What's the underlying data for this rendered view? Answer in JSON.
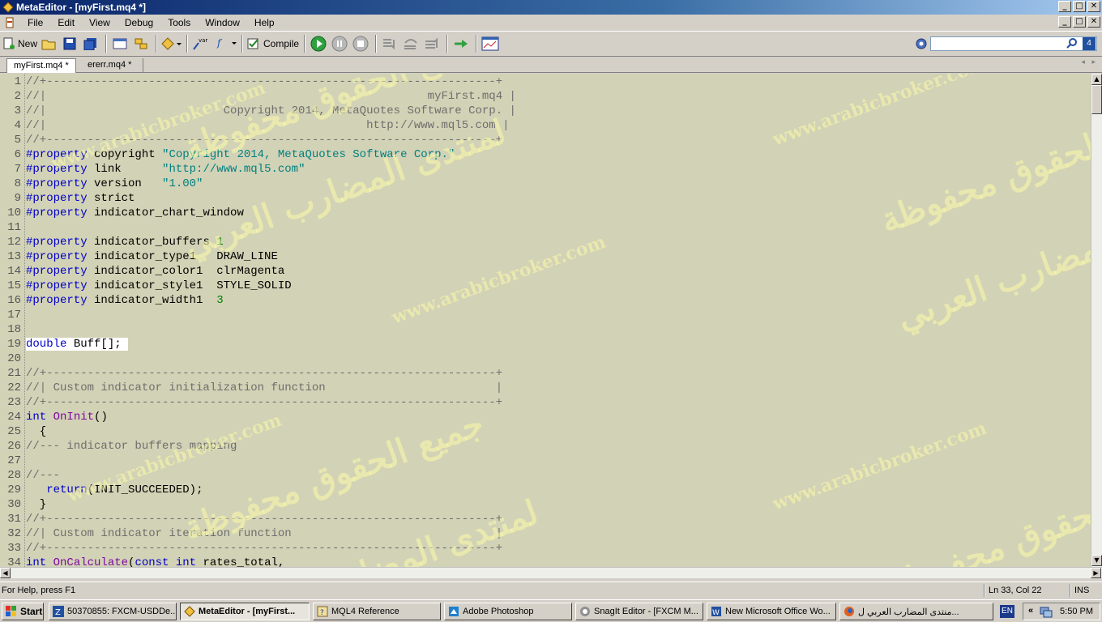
{
  "window": {
    "title": "MetaEditor - [myFirst.mq4 *]"
  },
  "menu": [
    "File",
    "Edit",
    "View",
    "Debug",
    "Tools",
    "Window",
    "Help"
  ],
  "toolbar": {
    "new_label": "New",
    "compile_label": "Compile"
  },
  "search": {
    "value": ""
  },
  "search_count": "4",
  "tabs": [
    {
      "label": "myFirst.mq4 *",
      "active": true
    },
    {
      "label": "ererr.mq4 *",
      "active": false
    }
  ],
  "code_lines": [
    [
      {
        "t": "//+------------------------------------------------------------------+",
        "c": "cmt"
      }
    ],
    [
      {
        "t": "//|                                                        myFirst.mq4 |",
        "c": "cmt"
      }
    ],
    [
      {
        "t": "//|                          Copyright 2014, MetaQuotes Software Corp. |",
        "c": "cmt"
      }
    ],
    [
      {
        "t": "//|                                               http://www.mql5.com |",
        "c": "cmt"
      }
    ],
    [
      {
        "t": "//+------------------------------------------------------------------+",
        "c": "cmt"
      }
    ],
    [
      {
        "t": "#property",
        "c": "kw"
      },
      {
        "t": " copyright ",
        "c": ""
      },
      {
        "t": "\"Copyright 2014, MetaQuotes Software Corp.\"",
        "c": "str"
      }
    ],
    [
      {
        "t": "#property",
        "c": "kw"
      },
      {
        "t": " link      ",
        "c": ""
      },
      {
        "t": "\"http://www.mql5.com\"",
        "c": "str"
      }
    ],
    [
      {
        "t": "#property",
        "c": "kw"
      },
      {
        "t": " version   ",
        "c": ""
      },
      {
        "t": "\"1.00\"",
        "c": "str"
      }
    ],
    [
      {
        "t": "#property",
        "c": "kw"
      },
      {
        "t": " strict",
        "c": ""
      }
    ],
    [
      {
        "t": "#property",
        "c": "kw"
      },
      {
        "t": " indicator_chart_window",
        "c": ""
      }
    ],
    [],
    [
      {
        "t": "#property",
        "c": "kw"
      },
      {
        "t": " indicator_buffers ",
        "c": ""
      },
      {
        "t": "1",
        "c": "num"
      }
    ],
    [
      {
        "t": "#property",
        "c": "kw"
      },
      {
        "t": " indicator_type1   DRAW_LINE",
        "c": ""
      }
    ],
    [
      {
        "t": "#property",
        "c": "kw"
      },
      {
        "t": " indicator_color1  clrMagenta",
        "c": ""
      }
    ],
    [
      {
        "t": "#property",
        "c": "kw"
      },
      {
        "t": " indicator_style1  STYLE_SOLID",
        "c": ""
      }
    ],
    [
      {
        "t": "#property",
        "c": "kw"
      },
      {
        "t": " indicator_width1  ",
        "c": ""
      },
      {
        "t": "3",
        "c": "num"
      }
    ],
    [],
    [],
    [
      {
        "t": "double",
        "c": "kw hl"
      },
      {
        "t": " Buff[]; ",
        "c": "hl"
      }
    ],
    [],
    [
      {
        "t": "//+------------------------------------------------------------------+",
        "c": "cmt"
      }
    ],
    [
      {
        "t": "//| Custom indicator initialization function                         |",
        "c": "cmt"
      }
    ],
    [
      {
        "t": "//+------------------------------------------------------------------+",
        "c": "cmt"
      }
    ],
    [
      {
        "t": "int",
        "c": "kw"
      },
      {
        "t": " ",
        "c": ""
      },
      {
        "t": "OnInit",
        "c": "fn"
      },
      {
        "t": "()",
        "c": ""
      }
    ],
    [
      {
        "t": "  {",
        "c": ""
      }
    ],
    [
      {
        "t": "//--- indicator buffers mapping",
        "c": "cmt"
      }
    ],
    [],
    [
      {
        "t": "//---",
        "c": "cmt"
      }
    ],
    [
      {
        "t": "   ",
        "c": ""
      },
      {
        "t": "return",
        "c": "kw"
      },
      {
        "t": "(INIT_SUCCEEDED);",
        "c": ""
      }
    ],
    [
      {
        "t": "  }",
        "c": ""
      }
    ],
    [
      {
        "t": "//+------------------------------------------------------------------+",
        "c": "cmt"
      }
    ],
    [
      {
        "t": "//| Custom indicator iteration function                              |",
        "c": "cmt"
      }
    ],
    [
      {
        "t": "//+------------------------------------------------------------------+",
        "c": "cmt"
      }
    ],
    [
      {
        "t": "int",
        "c": "kw"
      },
      {
        "t": " ",
        "c": ""
      },
      {
        "t": "OnCalculate",
        "c": "fn"
      },
      {
        "t": "(",
        "c": ""
      },
      {
        "t": "const int",
        "c": "kw"
      },
      {
        "t": " rates_total,",
        "c": ""
      }
    ]
  ],
  "watermarks": {
    "url": "www.arabicbroker.com",
    "ar1": "جميع الحقوق محفوظة",
    "ar2": "لمنتدى المضارب العربي"
  },
  "status": {
    "help": "For Help, press F1",
    "position": "Ln 33, Col 22",
    "mode": "INS"
  },
  "taskbar": {
    "start_label": "Start",
    "tasks": [
      {
        "label": "50370855: FXCM-USDDe...",
        "active": false
      },
      {
        "label": "MetaEditor - [myFirst...",
        "active": true
      },
      {
        "label": "MQL4 Reference",
        "active": false
      },
      {
        "label": "Adobe Photoshop",
        "active": false
      },
      {
        "label": "SnagIt Editor - [FXCM M...",
        "active": false
      },
      {
        "label": "New Microsoft Office Wo...",
        "active": false
      },
      {
        "label": "منتدى المضارب العربي ل...",
        "active": false
      }
    ],
    "lang": "EN",
    "clock": "5:50 PM"
  },
  "colors": {
    "editor_bg": "#d2d2b6",
    "keyword": "#0000c8",
    "string": "#008080",
    "comment": "#6e6e6e",
    "function": "#7d0aa0",
    "number": "#008000"
  }
}
